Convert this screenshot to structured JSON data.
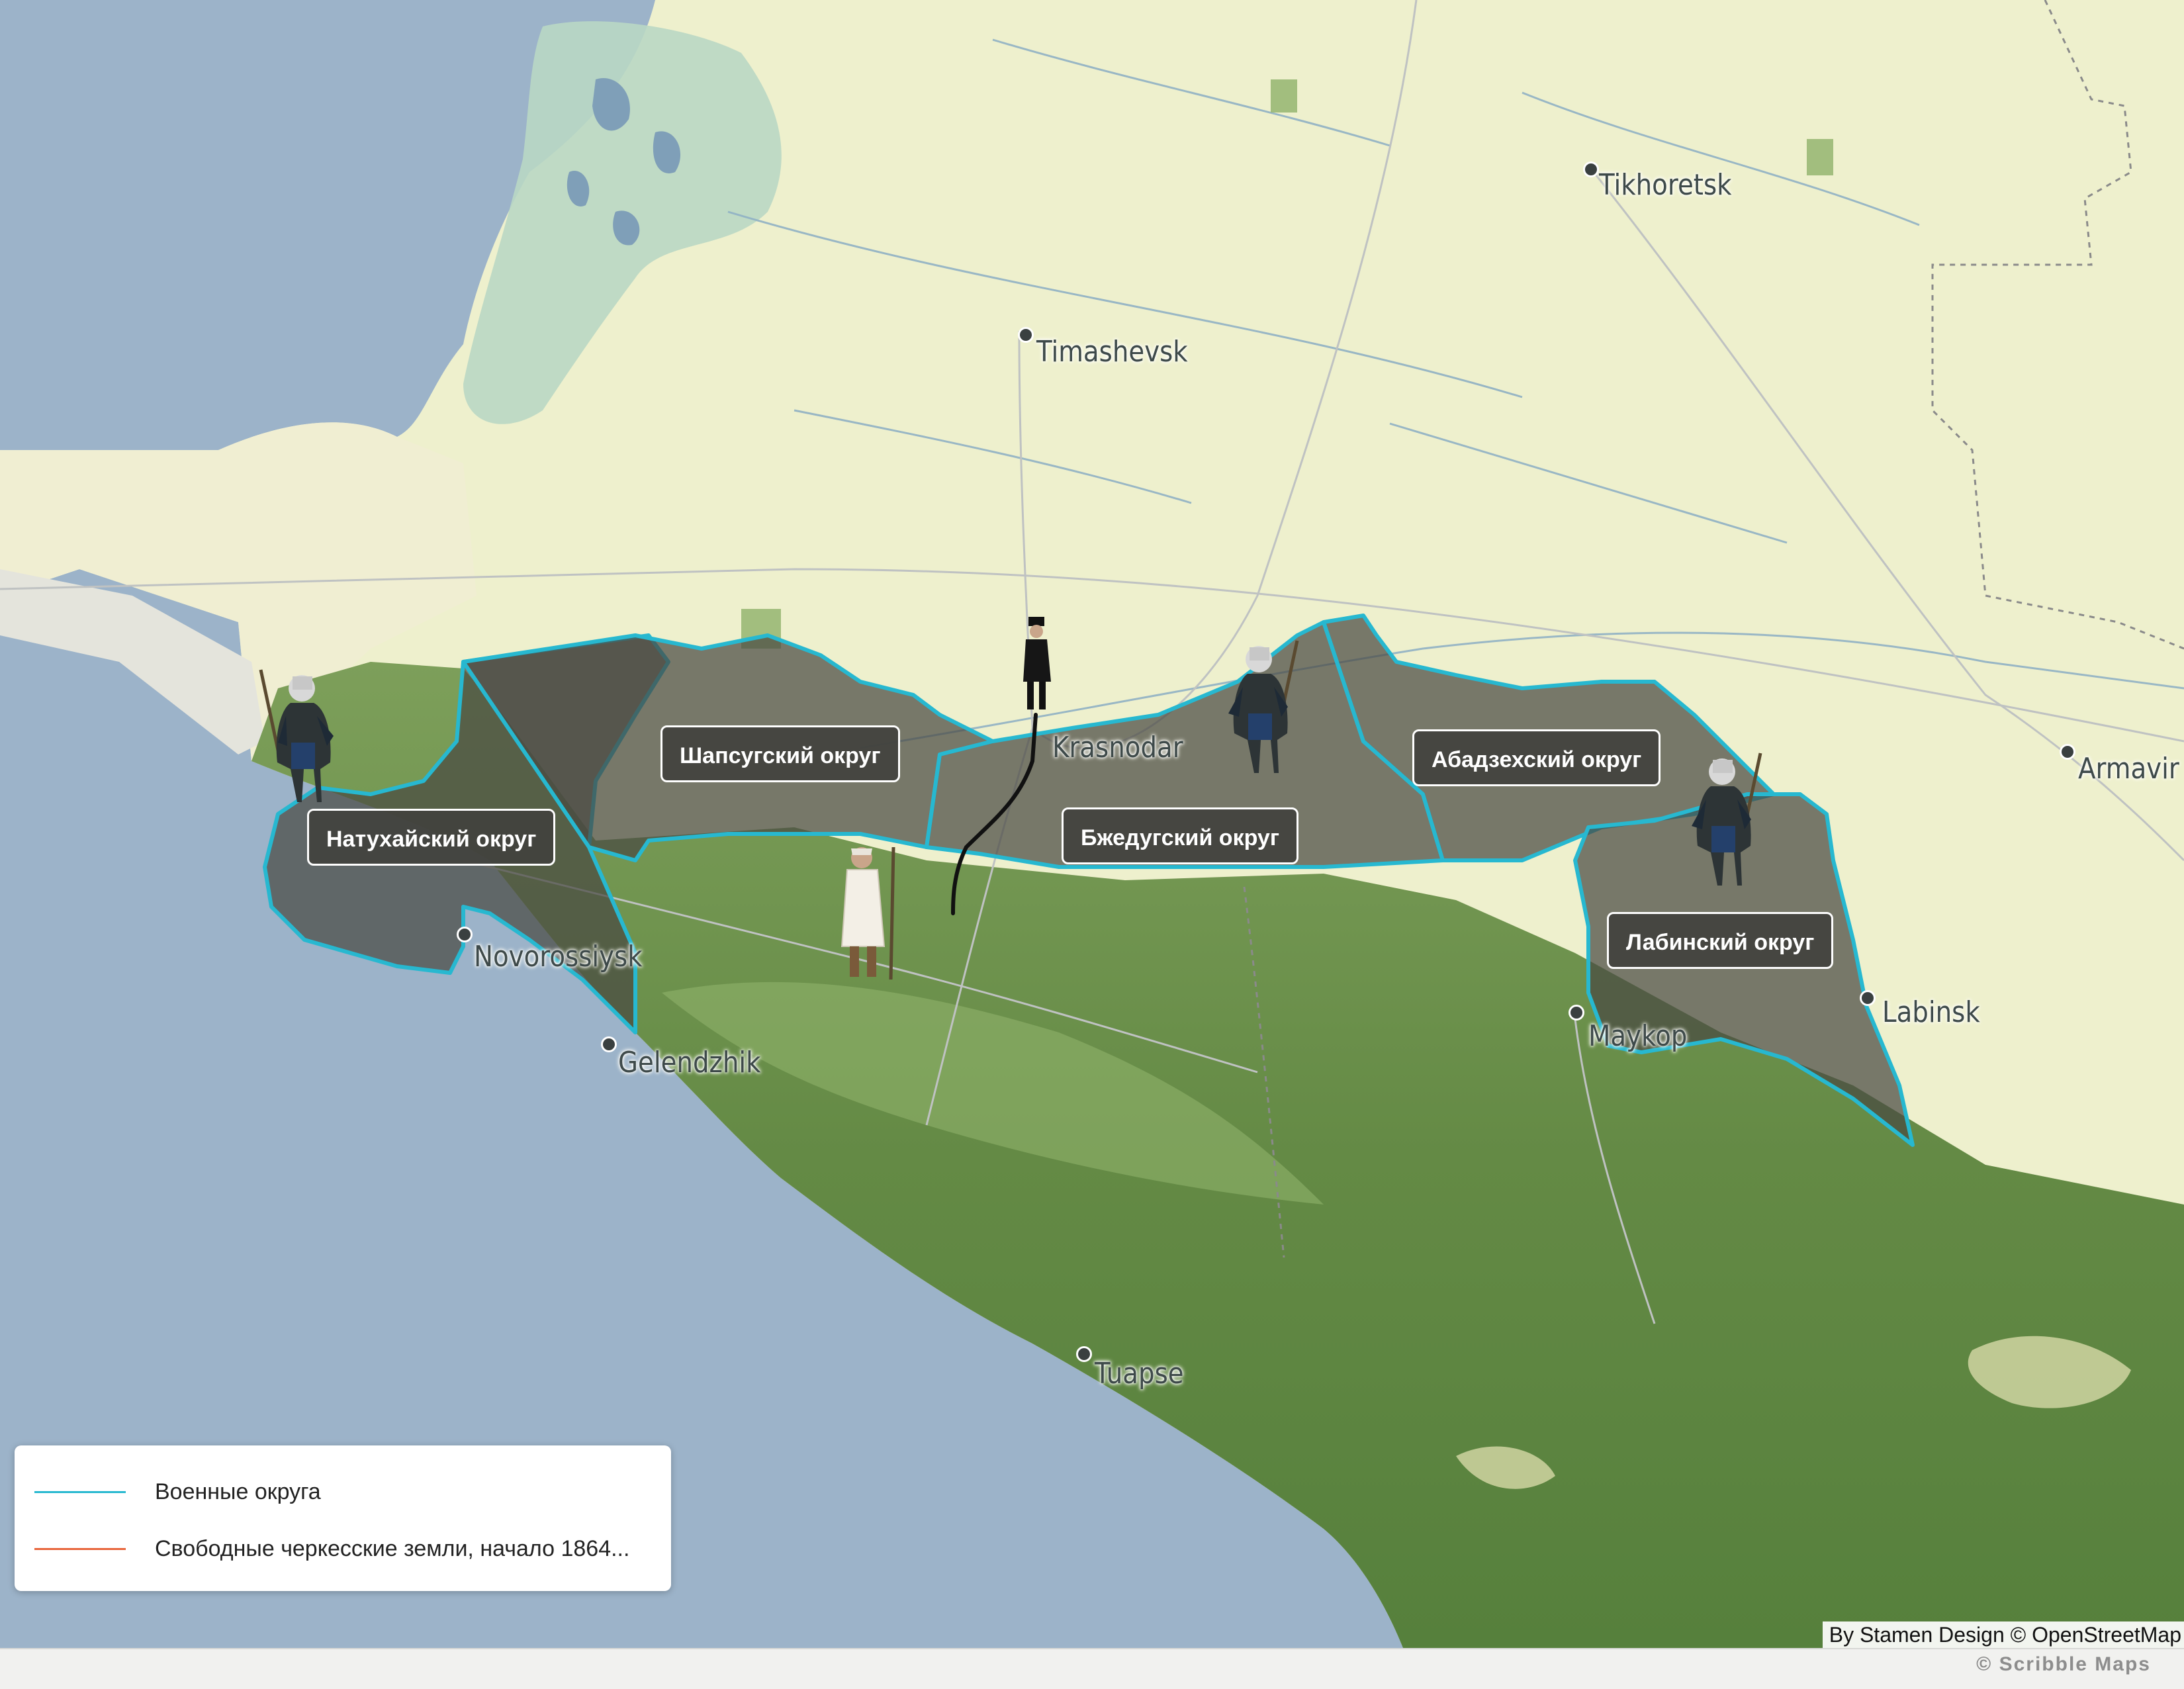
{
  "map": {
    "cities": [
      {
        "name": "Tikhoretsk"
      },
      {
        "name": "Timashevsk"
      },
      {
        "name": "Krasnodar"
      },
      {
        "name": "Armavir"
      },
      {
        "name": "Novorossiysk"
      },
      {
        "name": "Gelendzhik"
      },
      {
        "name": "Maykop"
      },
      {
        "name": "Labinsk"
      },
      {
        "name": "Tuapse"
      }
    ],
    "districts": [
      {
        "label": "Натухайский округ"
      },
      {
        "label": "Шапсугский округ"
      },
      {
        "label": "Бжедугский округ"
      },
      {
        "label": "Абадзехский округ"
      },
      {
        "label": "Лабинский округ"
      }
    ],
    "figures": [
      "circassian-warrior",
      "circassian-warrior",
      "circassian-warrior",
      "officer-figure",
      "highlander-figure"
    ]
  },
  "legend": {
    "items": [
      {
        "label": "Военные округа",
        "color": "#27b8d0"
      },
      {
        "label": "Свободные черкесские земли, начало 1864...",
        "color": "#e8643a"
      }
    ]
  },
  "attribution": "By Stamen Design © OpenStreetMap",
  "footer": {
    "brand": "© Scribble Maps"
  },
  "colors": {
    "sea": "#9cb3c9",
    "land": "#eef0cd",
    "forest": "#6f9450",
    "district_fill": "#4a4a42",
    "district_stroke": "#27b8d0",
    "path_line": "#111111"
  }
}
